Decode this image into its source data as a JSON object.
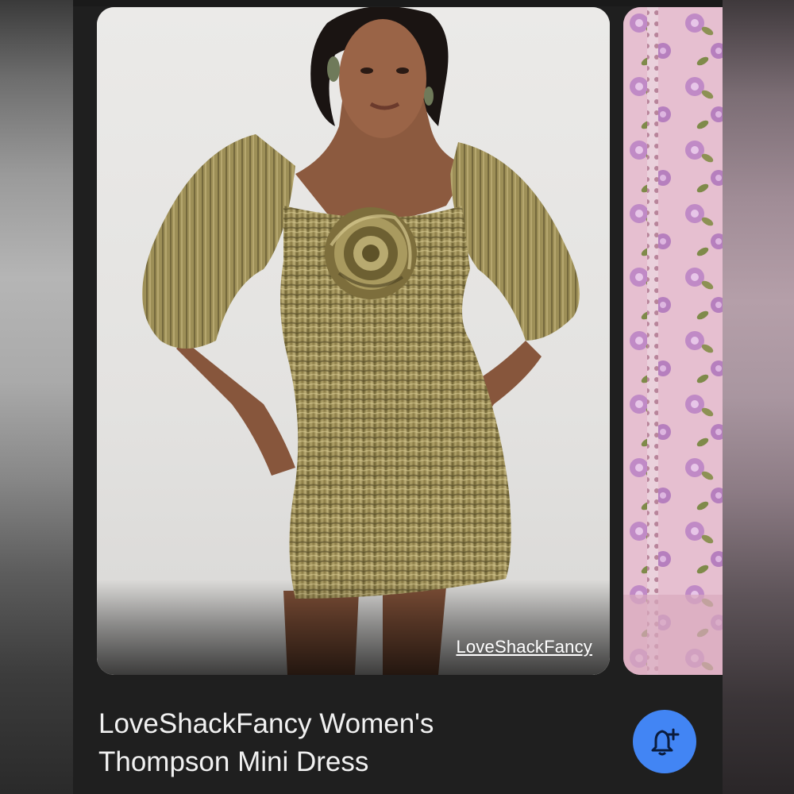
{
  "result": {
    "source": "LoveShackFancy",
    "title_line1": "LoveShackFancy Women's",
    "title_line2": "Thompson Mini Dress"
  },
  "icons": {
    "alert_button": "bell-plus-icon"
  },
  "colors": {
    "background": "#1f1f1f",
    "accent_button": "#4285f4",
    "dress_gold": "#9a8a55",
    "next_card_pink": "#e4bccc"
  }
}
